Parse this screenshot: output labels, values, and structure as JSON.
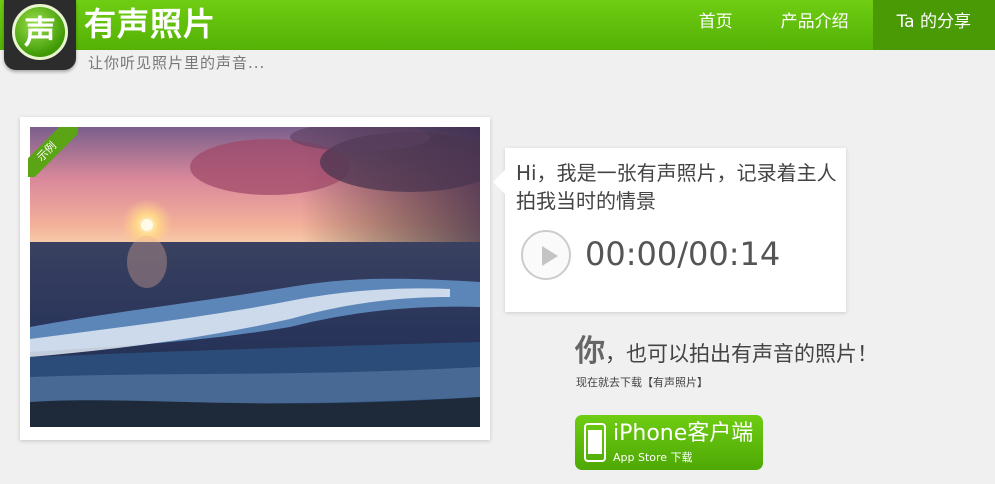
{
  "header": {
    "logo_char": "声",
    "brand": "有声照片",
    "tagline": "让你听见照片里的声音...",
    "nav": [
      {
        "label": "首页",
        "active": false
      },
      {
        "label": "产品介绍",
        "active": false
      },
      {
        "label": "Ta 的分享",
        "active": true
      }
    ]
  },
  "photo": {
    "ribbon": "示例",
    "subject": "sunset-over-sea"
  },
  "bubble": {
    "text": "Hi，我是一张有声照片，记录着主人拍我当时的情景",
    "time": "00:00/00:14"
  },
  "cta": {
    "emphasis": "你",
    "rest": "，也可以拍出有声音的照片！",
    "sub": "现在就去下载【有声照片】"
  },
  "download": {
    "title": "iPhone客户端",
    "sub": "App Store 下载"
  },
  "colors": {
    "brand_green": "#5fbf0a",
    "nav_active": "#4a9a06",
    "background": "#f0f0f0"
  }
}
